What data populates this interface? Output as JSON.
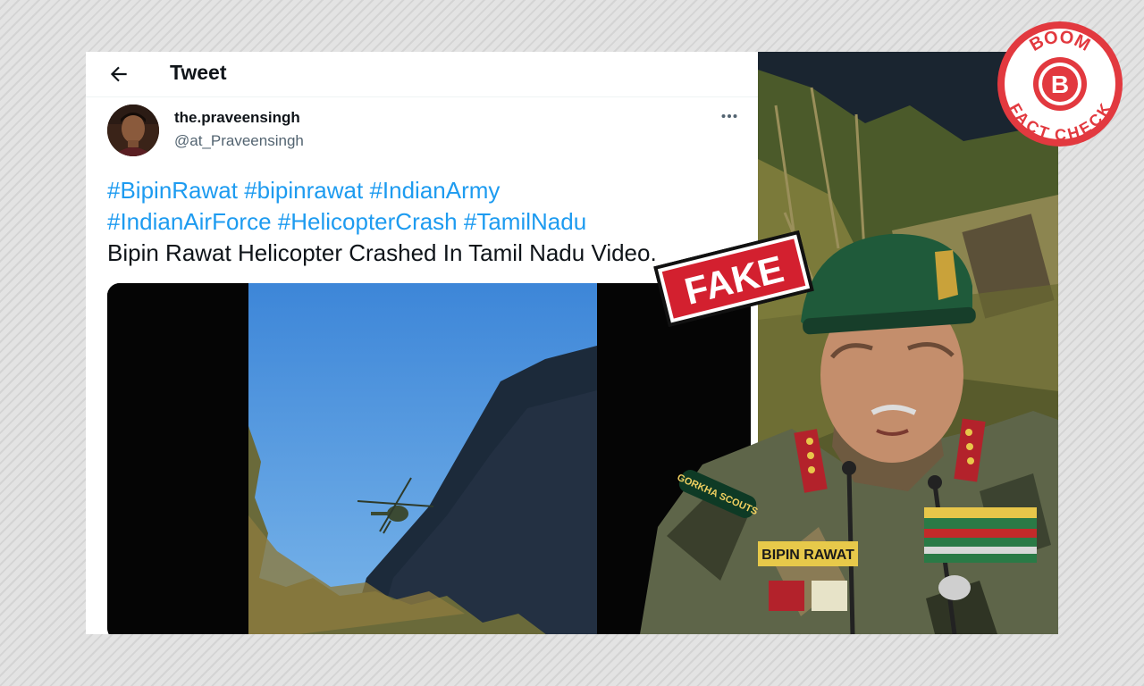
{
  "tweet": {
    "header_title": "Tweet",
    "user": {
      "display_name": "the.praveensingh",
      "handle": "@at_Praveensingh"
    },
    "hashtags_line1": [
      "#BipinRawat",
      "#bipinrawat",
      "#IndianArmy"
    ],
    "hashtags_line2": [
      "#IndianAirForce",
      "#HelicopterCrash",
      "#TamilNadu"
    ],
    "body": "Bipin Rawat Helicopter Crashed In Tamil Nadu Video."
  },
  "overlay": {
    "stamp_text": "FAKE",
    "badge_top": "BOOM",
    "badge_letter": "B",
    "badge_bottom": "FACT CHECK",
    "name_tape": "BIPIN RAWAT",
    "shoulder_patch": "GORKHA SCOUTS"
  },
  "colors": {
    "link_blue": "#1d9bf0",
    "stamp_red": "#d3202f",
    "boom_red": "#e2393f"
  },
  "icons": [
    "back-arrow-icon",
    "more-options-icon"
  ]
}
